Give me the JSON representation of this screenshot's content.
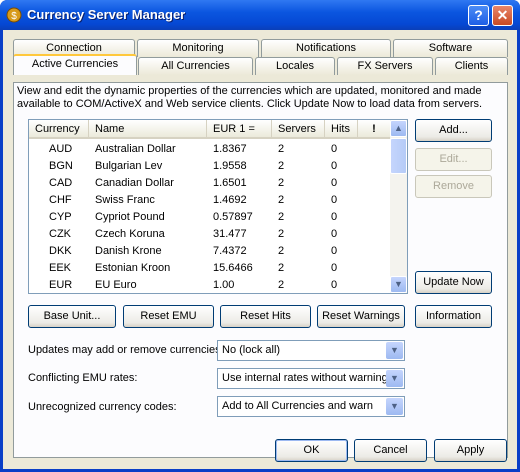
{
  "window": {
    "title": "Currency Server Manager",
    "help": "?",
    "close": "✕"
  },
  "tabs_row1": [
    "Connection",
    "Monitoring",
    "Notifications",
    "Software"
  ],
  "tabs_row2": [
    "Active Currencies",
    "All Currencies",
    "Locales",
    "FX Servers",
    "Clients"
  ],
  "description": "View and edit the dynamic properties of the currencies which are updated, monitored and made available to COM/ActiveX and Web service clients. Click Update Now to load data from servers.",
  "list": {
    "headers": [
      "Currency",
      "Name",
      "EUR 1 =",
      "Servers",
      "Hits",
      "!"
    ],
    "rows": [
      [
        "AUD",
        "Australian Dollar",
        "1.8367",
        "2",
        "0"
      ],
      [
        "BGN",
        "Bulgarian Lev",
        "1.9558",
        "2",
        "0"
      ],
      [
        "CAD",
        "Canadian Dollar",
        "1.6501",
        "2",
        "0"
      ],
      [
        "CHF",
        "Swiss Franc",
        "1.4692",
        "2",
        "0"
      ],
      [
        "CYP",
        "Cypriot Pound",
        "0.57897",
        "2",
        "0"
      ],
      [
        "CZK",
        "Czech Koruna",
        "31.477",
        "2",
        "0"
      ],
      [
        "DKK",
        "Danish Krone",
        "7.4372",
        "2",
        "0"
      ],
      [
        "EEK",
        "Estonian Kroon",
        "15.6466",
        "2",
        "0"
      ],
      [
        "EUR",
        "EU Euro",
        "1.00",
        "2",
        "0"
      ]
    ]
  },
  "side_buttons": {
    "add": "Add...",
    "edit": "Edit...",
    "remove": "Remove",
    "update_now": "Update Now"
  },
  "row_buttons": {
    "base_unit": "Base Unit...",
    "reset_emu": "Reset EMU",
    "reset_hits": "Reset Hits",
    "reset_warnings": "Reset Warnings",
    "information": "Information"
  },
  "options": [
    {
      "label": "Updates may add or remove currencies:",
      "value": "No (lock all)"
    },
    {
      "label": "Conflicting EMU rates:",
      "value": "Use internal rates without warning"
    },
    {
      "label": "Unrecognized currency codes:",
      "value": "Add to All Currencies and warn"
    }
  ],
  "dialog_buttons": {
    "ok": "OK",
    "cancel": "Cancel",
    "apply": "Apply"
  }
}
